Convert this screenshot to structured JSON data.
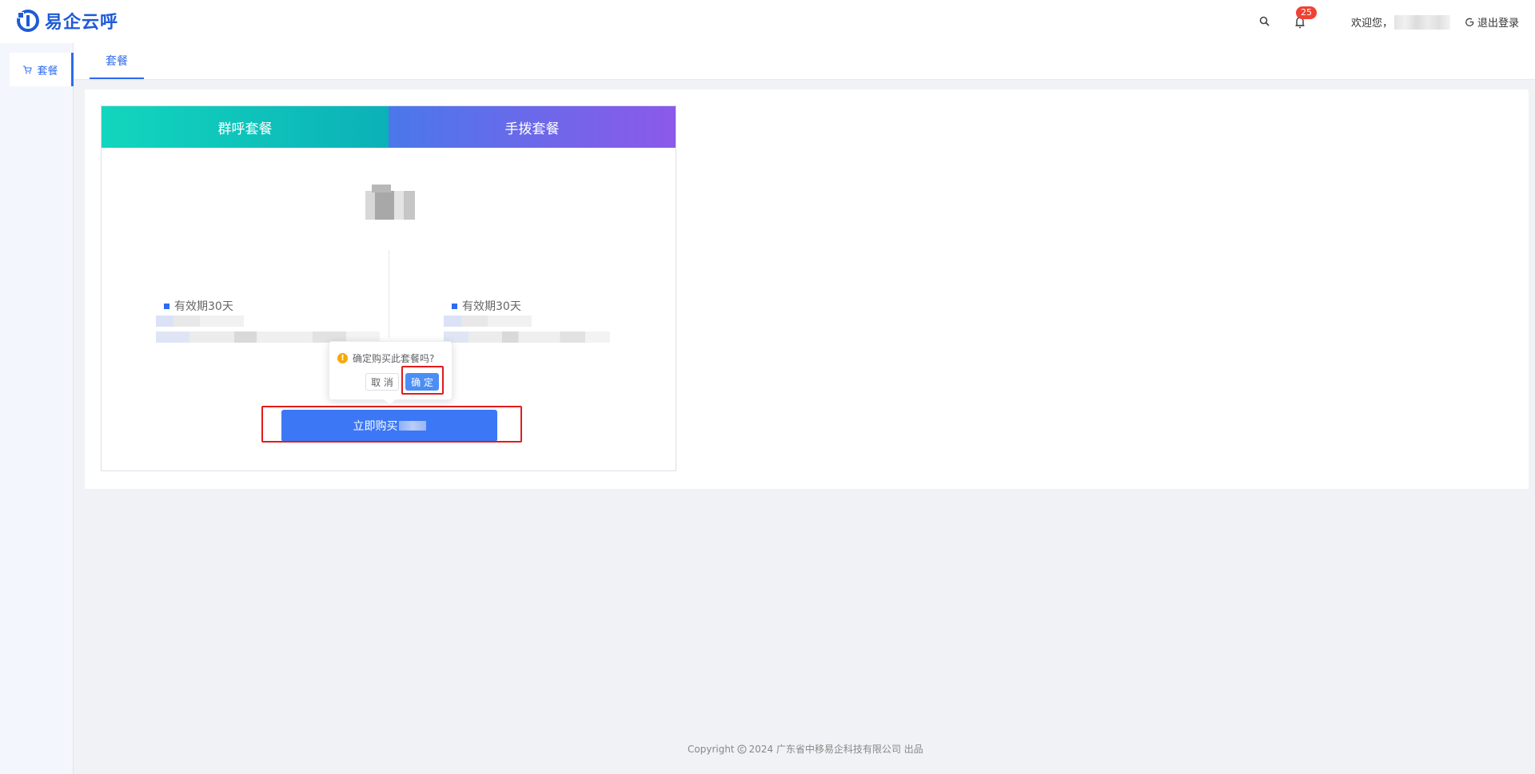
{
  "header": {
    "logo_text": "易企云呼",
    "notification_count": "25",
    "welcome_text": "欢迎您，",
    "logout_label": "退出登录"
  },
  "sidebar": {
    "items": [
      {
        "label": "套餐",
        "icon": "cart-icon",
        "active": true
      }
    ]
  },
  "tabs": [
    {
      "label": "套餐",
      "active": true
    }
  ],
  "package": {
    "tabs": [
      {
        "label": "群呼套餐"
      },
      {
        "label": "手拨套餐"
      }
    ],
    "features": [
      {
        "label": "有效期30天"
      },
      {
        "label": "有效期30天"
      }
    ],
    "buy_label": "立即购买"
  },
  "popconfirm": {
    "message": "确定购买此套餐吗?",
    "cancel_label": "取 消",
    "confirm_label": "确 定"
  },
  "footer": {
    "copyright_label": "Copyright",
    "year_owner": "2024 广东省中移易企科技有限公司 出品"
  },
  "colors": {
    "primary": "#2d6bf0",
    "highlight": "#e21b1b",
    "tab_group_call": "#12d6bd",
    "tab_manual_call": "#8c59ea",
    "warning": "#f6a80b"
  }
}
